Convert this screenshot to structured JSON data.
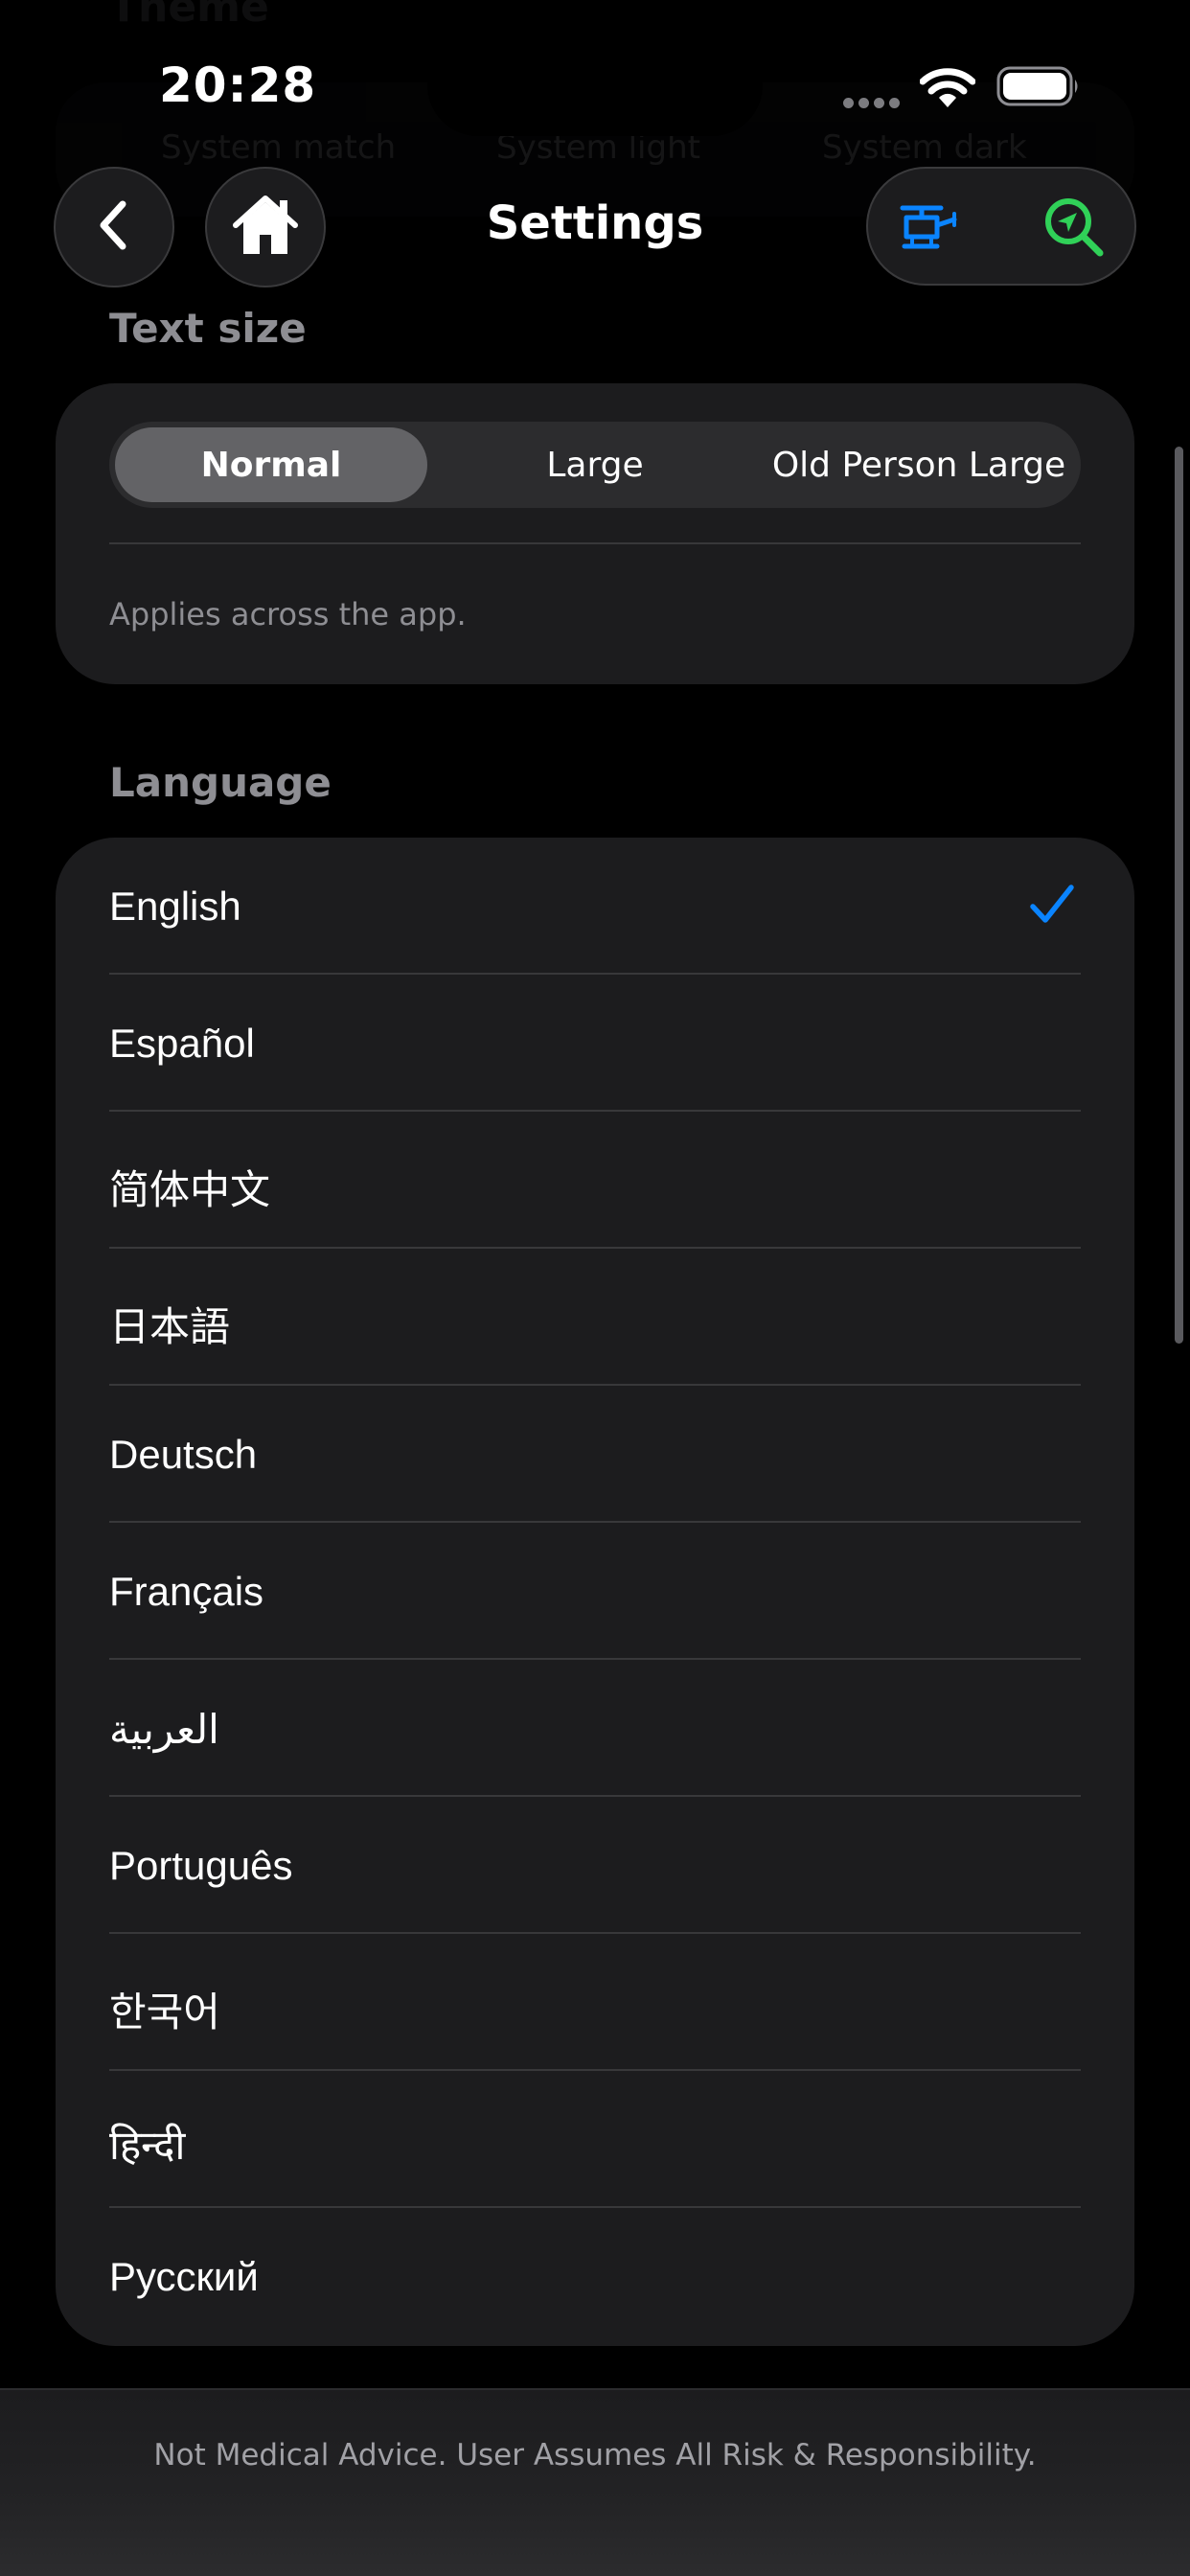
{
  "status_bar": {
    "time": "20:28"
  },
  "background_section": {
    "title": "Theme",
    "options": [
      "System match",
      "System light",
      "System dark"
    ]
  },
  "header": {
    "title": "Settings",
    "accent_blue": "#0A84FF",
    "accent_green": "#30D158",
    "icons": [
      "chevron-left-icon",
      "home-icon",
      "helicopter-icon",
      "search-location-icon"
    ]
  },
  "text_size": {
    "header": "Text size",
    "options": [
      "Normal",
      "Large",
      "Old Person Large"
    ],
    "selected": "Normal",
    "note": "Applies across the app."
  },
  "language": {
    "header": "Language",
    "selected": "English",
    "items": [
      "English",
      "Español",
      "简体中文",
      "日本語",
      "Deutsch",
      "Français",
      "العربية",
      "Português",
      "한국어",
      "हिन्दी",
      "Русский"
    ]
  },
  "footer": {
    "disclaimer": "Not Medical Advice. User Assumes All Risk & Responsibility."
  }
}
